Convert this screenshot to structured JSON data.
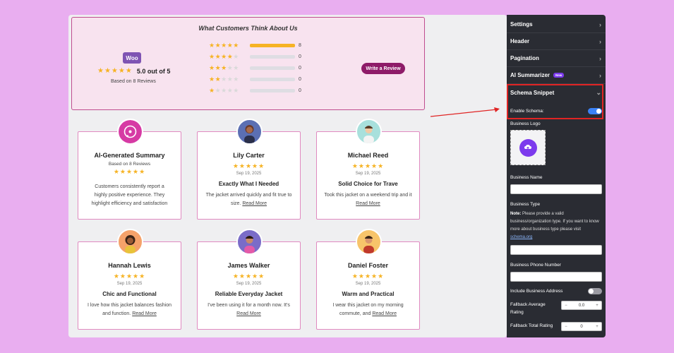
{
  "summary": {
    "title": "What Customers Think About Us",
    "logo_text": "Woo",
    "average_stars": "★★★★★",
    "average_text": "5.0 out of 5",
    "based_on": "Based on 8 Reviews",
    "distribution": [
      {
        "stars": 5,
        "count": "8",
        "fraction": 1.0
      },
      {
        "stars": 4,
        "count": "0",
        "fraction": 0
      },
      {
        "stars": 3,
        "count": "0",
        "fraction": 0
      },
      {
        "stars": 2,
        "count": "0",
        "fraction": 0
      },
      {
        "stars": 1,
        "count": "0",
        "fraction": 0
      }
    ],
    "write_review": "Write a Review"
  },
  "ai_card": {
    "title": "AI-Generated Summary",
    "subtitle": "Based on 8 Reviews",
    "stars": "★★★★★",
    "body": "Customers consistently report a highly positive experience. They highlight efficiency and satisfaction with the purchase."
  },
  "reviews": [
    {
      "name": "Lily Carter",
      "stars": "★★★★★",
      "date": "Sep 19, 2025",
      "title": "Exactly What I Needed",
      "body": "The jacket arrived quickly and fit true to size.",
      "read_more": "Read More"
    },
    {
      "name": "Michael Reed",
      "stars": "★★★★★",
      "date": "Sep 19, 2025",
      "title": "Solid Choice for Trave",
      "body": "Took this jacket on a weekend trip and it",
      "read_more": "Read More"
    },
    {
      "name": "Hannah Lewis",
      "stars": "★★★★★",
      "date": "Sep 19, 2025",
      "title": "Chic and Functional",
      "body": "I love how this jacket balances fashion and function.",
      "read_more": "Read More"
    },
    {
      "name": "James Walker",
      "stars": "★★★★★",
      "date": "Sep 19, 2025",
      "title": "Reliable Everyday Jacket",
      "body": "I've been using it for a month now. It's",
      "read_more": "Read More"
    },
    {
      "name": "Daniel Foster",
      "stars": "★★★★★",
      "date": "Sep 19, 2025",
      "title": "Warm and Practical",
      "body": "I wear this jacket on my morning commute, and",
      "read_more": "Read More"
    }
  ],
  "panel": {
    "sections": [
      {
        "label": "Settings"
      },
      {
        "label": "Header"
      },
      {
        "label": "Pagination"
      },
      {
        "label": "AI Summarizer",
        "badge": "New"
      },
      {
        "label": "Schema Snippet"
      }
    ],
    "enable_schema": {
      "label": "Enable Schema:",
      "on": true
    },
    "business_logo": "Business Logo",
    "business_name": "Business Name",
    "business_type": "Business Type",
    "note_bold": "Note:",
    "note_text": " Please provide a valid business/organization type. If you want to know more about business type please visit ",
    "note_link": "schema.org",
    "business_phone": "Business Phone Number",
    "include_address": {
      "label": "Include Business Address",
      "on": false
    },
    "fallback_avg": {
      "label": "Fallback Average Rating",
      "value": "0.0"
    },
    "fallback_total": {
      "label": "Fallback Total Rating",
      "value": "0"
    }
  },
  "colors": {
    "accent_pink": "#c04d8f",
    "button": "#8e1b68",
    "star": "#f6b324",
    "panel_bg": "#2a2c33",
    "toggle_on": "#3b82f6",
    "highlight": "#e02424"
  }
}
